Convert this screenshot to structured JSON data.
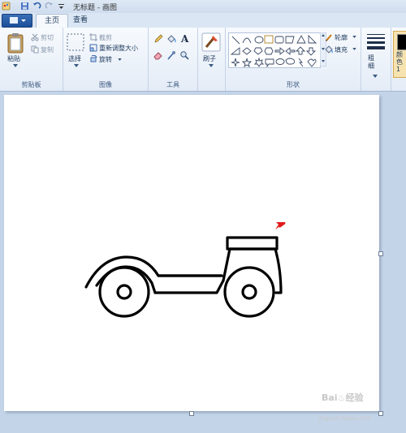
{
  "window": {
    "title": "无标题 - 画图"
  },
  "tabs": [
    {
      "label": "主页",
      "active": true
    },
    {
      "label": "查看",
      "active": false
    }
  ],
  "clipboard": {
    "paste": "粘贴",
    "cut": "剪切",
    "copy": "复制",
    "group_label": "剪贴板"
  },
  "image": {
    "select": "选择",
    "crop": "截剪",
    "resize": "重新调整大小",
    "rotate": "旋转",
    "group_label": "图像"
  },
  "tools": {
    "group_label": "工具"
  },
  "brushes": {
    "label": "刷子"
  },
  "shapes": {
    "outline": "轮廓",
    "fill": "填充",
    "group_label": "形状"
  },
  "size": {
    "label": "粗细"
  },
  "color": {
    "label": "颜色1",
    "value": "#000000"
  },
  "accent": {
    "selection": "#e8b84a",
    "arrow": "#e21b1b"
  },
  "watermark": {
    "text": "Bai♨经验",
    "url": "jingyan.baidu.com"
  }
}
